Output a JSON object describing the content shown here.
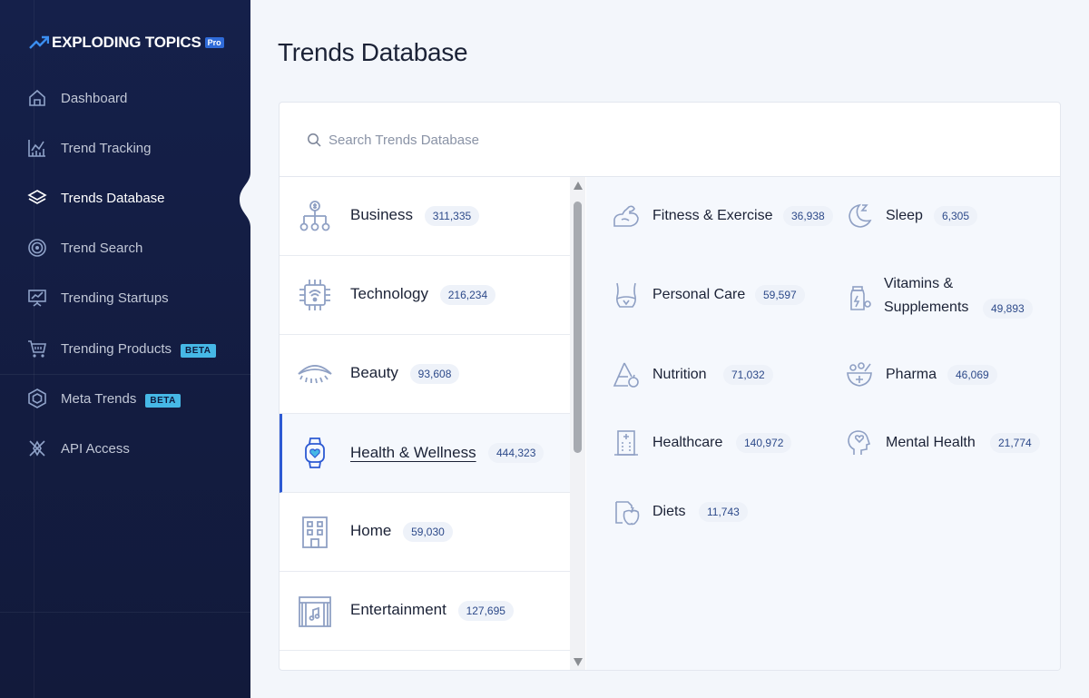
{
  "brand": {
    "name": "EXPLODING TOPICS",
    "tier": "Pro"
  },
  "sidebar": {
    "items": [
      {
        "label": "Dashboard",
        "icon": "home-icon",
        "active": false
      },
      {
        "label": "Trend Tracking",
        "icon": "chart-icon",
        "active": false
      },
      {
        "label": "Trends Database",
        "icon": "layers-icon",
        "active": true
      },
      {
        "label": "Trend Search",
        "icon": "target-icon",
        "active": false
      },
      {
        "label": "Trending Startups",
        "icon": "presentation-icon",
        "active": false
      },
      {
        "label": "Trending Products",
        "icon": "cart-icon",
        "active": false,
        "badge": "BETA"
      },
      {
        "label": "Meta Trends",
        "icon": "hexagon-icon",
        "active": false,
        "badge": "BETA"
      },
      {
        "label": "API Access",
        "icon": "network-icon",
        "active": false
      }
    ]
  },
  "page": {
    "title": "Trends Database"
  },
  "search": {
    "placeholder": "Search Trends Database"
  },
  "categories": [
    {
      "name": "Business",
      "count": "311,335",
      "icon": "business-icon"
    },
    {
      "name": "Technology",
      "count": "216,234",
      "icon": "chip-icon"
    },
    {
      "name": "Beauty",
      "count": "93,608",
      "icon": "eye-lash-icon"
    },
    {
      "name": "Health & Wellness",
      "count": "444,323",
      "icon": "smartwatch-heart-icon",
      "active": true
    },
    {
      "name": "Home",
      "count": "59,030",
      "icon": "building-icon"
    },
    {
      "name": "Entertainment",
      "count": "127,695",
      "icon": "theater-icon"
    }
  ],
  "subcategories": [
    {
      "name": "Fitness & Exercise",
      "count": "36,938",
      "icon": "arm-muscle-icon"
    },
    {
      "name": "Sleep",
      "count": "6,305",
      "icon": "moon-zzz-icon"
    },
    {
      "name": "Personal Care",
      "count": "59,597",
      "icon": "body-icon"
    },
    {
      "name": "Vitamins &",
      "name2": "Supplements",
      "count": "49,893",
      "icon": "bottle-icon"
    },
    {
      "name": "Nutrition",
      "count": "71,032",
      "icon": "triangle-apple-icon"
    },
    {
      "name": "Pharma",
      "count": "46,069",
      "icon": "mortar-icon"
    },
    {
      "name": "Healthcare",
      "count": "140,972",
      "icon": "hospital-icon"
    },
    {
      "name": "Mental Health",
      "count": "21,774",
      "icon": "head-heart-icon"
    },
    {
      "name": "Diets",
      "count": "11,743",
      "icon": "apple-note-icon"
    }
  ],
  "colors": {
    "sidebar_bg": "#15204a",
    "accent": "#2d5ad3",
    "beta": "#46b8e6",
    "badge_bg": "#eef2f9"
  }
}
